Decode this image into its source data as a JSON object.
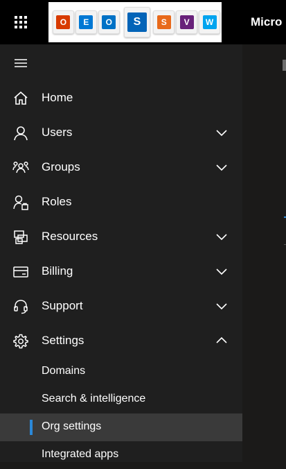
{
  "header": {
    "title": "Micro",
    "banner_apps": [
      {
        "letter": "O",
        "color": "#d83b01"
      },
      {
        "letter": "E",
        "color": "#0078d4"
      },
      {
        "letter": "O",
        "color": "#0072c6"
      },
      {
        "letter": "S",
        "color": "#0364b8"
      },
      {
        "letter": "S",
        "color": "#e86a1b"
      },
      {
        "letter": "V",
        "color": "#68217a"
      },
      {
        "letter": "W",
        "color": "#00a4ef"
      }
    ]
  },
  "sidebar": {
    "items": [
      {
        "label": "Home",
        "icon": "home-icon"
      },
      {
        "label": "Users",
        "icon": "user-icon",
        "expanded": false
      },
      {
        "label": "Groups",
        "icon": "groups-icon",
        "expanded": false
      },
      {
        "label": "Roles",
        "icon": "roles-icon"
      },
      {
        "label": "Resources",
        "icon": "resources-icon",
        "expanded": false
      },
      {
        "label": "Billing",
        "icon": "billing-icon",
        "expanded": false
      },
      {
        "label": "Support",
        "icon": "headset-icon",
        "expanded": false
      },
      {
        "label": "Settings",
        "icon": "gear-icon",
        "expanded": true
      }
    ],
    "settings_sub": [
      {
        "label": "Domains"
      },
      {
        "label": "Search & intelligence"
      },
      {
        "label": "Org settings",
        "active": true
      },
      {
        "label": "Integrated apps"
      }
    ]
  },
  "colors": {
    "accent": "#2b88d8",
    "header_bg": "#000000",
    "sidebar_bg": "#1f1f1f",
    "active_bg": "#3a3a3a"
  }
}
